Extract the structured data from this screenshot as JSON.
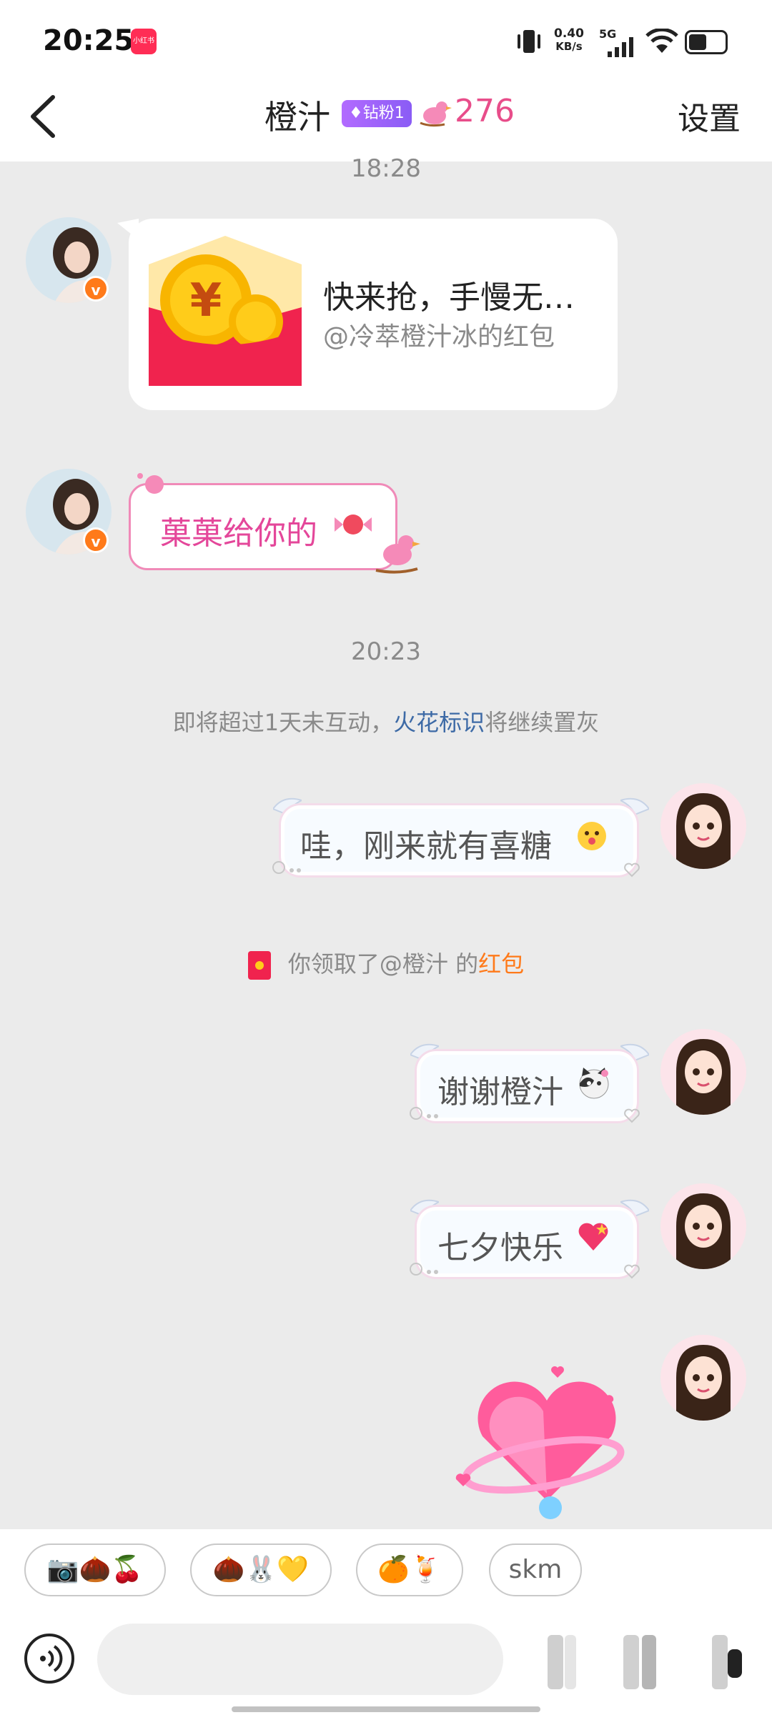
{
  "status_bar": {
    "time": "20:25",
    "app_badge": "小红书",
    "net_speed_value": "0.40",
    "net_speed_unit": "KB/s",
    "network": "5G",
    "battery_level": 0.5
  },
  "header": {
    "title": "橙汁",
    "fan_badge": "钻粉1",
    "level": "276",
    "settings_label": "设置"
  },
  "chat": {
    "timestamp_1": "18:28",
    "red_packet": {
      "title": "快来抢，手慢无…",
      "subtitle": "@冷萃橙汁冰的红包"
    },
    "candy_message": "菓菓给你的",
    "timestamp_2": "20:23",
    "notice": {
      "prefix": "即将超过1天未互动，",
      "link": "火花标识",
      "suffix": "将继续置灰"
    },
    "my_message_1": "哇，刚来就有喜糖",
    "received_notice": {
      "prefix": "你领取了@橙汁 的",
      "highlight": "红包"
    },
    "my_message_2": "谢谢橙汁",
    "my_message_3": "七夕快乐"
  },
  "quick_replies": [
    "📷🌰🍒",
    "🌰🐰💛",
    "🍊🍹",
    "skm"
  ],
  "colors": {
    "accent_pink": "#e84d8a",
    "link_blue": "#3d6aa6",
    "packet_red": "#f0234e",
    "orange": "#ff7a1a"
  }
}
